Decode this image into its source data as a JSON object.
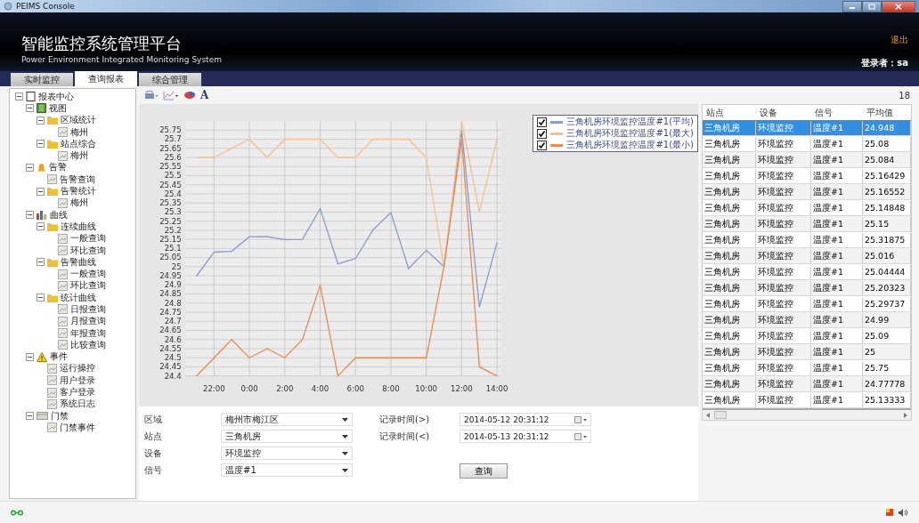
{
  "window": {
    "title": "PEIMS Console"
  },
  "header": {
    "title": "智能监控系统管理平台",
    "subtitle": "Power Environment Integrated Monitoring System",
    "logout": "退出",
    "user": "登录者：sa"
  },
  "tabs": [
    {
      "label": "实时监控",
      "selected": false
    },
    {
      "label": "查询报表",
      "selected": true
    },
    {
      "label": "综合管理",
      "selected": false
    }
  ],
  "tree": [
    {
      "label": "报表中心",
      "kind": "root",
      "expanded": true,
      "children": [
        {
          "label": "视图",
          "kind": "view",
          "expanded": true,
          "children": [
            {
              "label": "区域统计",
              "kind": "folder",
              "expanded": true,
              "children": [
                {
                  "label": "梅州",
                  "kind": "leaf"
                }
              ]
            },
            {
              "label": "站点综合",
              "kind": "folder",
              "expanded": true,
              "children": [
                {
                  "label": "梅州",
                  "kind": "leaf"
                }
              ]
            }
          ]
        },
        {
          "label": "告警",
          "kind": "alarm",
          "expanded": true,
          "children": [
            {
              "label": "告警查询",
              "kind": "leaf"
            },
            {
              "label": "告警统计",
              "kind": "folder",
              "expanded": true,
              "children": [
                {
                  "label": "梅州",
                  "kind": "leaf"
                }
              ]
            }
          ]
        },
        {
          "label": "曲线",
          "kind": "curve",
          "expanded": true,
          "children": [
            {
              "label": "连续曲线",
              "kind": "folder",
              "expanded": true,
              "children": [
                {
                  "label": "一般查询",
                  "kind": "leaf"
                },
                {
                  "label": "环比查询",
                  "kind": "leaf"
                }
              ]
            },
            {
              "label": "告警曲线",
              "kind": "folder",
              "expanded": true,
              "children": [
                {
                  "label": "一般查询",
                  "kind": "leaf"
                },
                {
                  "label": "环比查询",
                  "kind": "leaf"
                }
              ]
            },
            {
              "label": "统计曲线",
              "kind": "folder",
              "expanded": true,
              "children": [
                {
                  "label": "日报查询",
                  "kind": "leaf"
                },
                {
                  "label": "月报查询",
                  "kind": "leaf"
                },
                {
                  "label": "年报查询",
                  "kind": "leaf"
                },
                {
                  "label": "比较查询",
                  "kind": "leaf"
                }
              ]
            }
          ]
        },
        {
          "label": "事件",
          "kind": "event",
          "expanded": true,
          "children": [
            {
              "label": "运行操控",
              "kind": "leaf"
            },
            {
              "label": "用户登录",
              "kind": "leaf"
            },
            {
              "label": "客户登录",
              "kind": "leaf"
            },
            {
              "label": "系统日志",
              "kind": "leaf"
            }
          ]
        },
        {
          "label": "门禁",
          "kind": "door",
          "expanded": true,
          "children": [
            {
              "label": "门禁事件",
              "kind": "leaf"
            }
          ]
        }
      ]
    }
  ],
  "toolbar": {
    "font_label": "A"
  },
  "chart": {
    "chart_data": {
      "type": "line",
      "grid": true,
      "x": [
        "2014-05-12T21:00",
        "2014-05-12T22:00",
        "2014-05-12T23:00",
        "2014-05-13T00:00",
        "2014-05-13T01:00",
        "2014-05-13T02:00",
        "2014-05-13T03:00",
        "2014-05-13T04:00",
        "2014-05-13T05:00",
        "2014-05-13T06:00",
        "2014-05-13T07:00",
        "2014-05-13T08:00",
        "2014-05-13T09:00",
        "2014-05-13T10:00",
        "2014-05-13T11:00",
        "2014-05-13T12:00",
        "2014-05-13T13:00",
        "2014-05-13T14:00"
      ],
      "xlim": [
        "2014-05-12T20:24",
        "2014-05-13T14:12"
      ],
      "ylim": [
        24.4,
        25.8
      ],
      "xticks": [
        {
          "value": "2014-05-12T22:00",
          "label": "22:00"
        },
        {
          "value": "2014-05-13T00:00",
          "label": "0:00"
        },
        {
          "value": "2014-05-13T02:00",
          "label": "2:00"
        },
        {
          "value": "2014-05-13T04:00",
          "label": "4:00"
        },
        {
          "value": "2014-05-13T06:00",
          "label": "6:00"
        },
        {
          "value": "2014-05-13T08:00",
          "label": "8:00"
        },
        {
          "value": "2014-05-13T10:00",
          "label": "10:00"
        },
        {
          "value": "2014-05-13T12:00",
          "label": "12:00"
        },
        {
          "value": "2014-05-13T14:00",
          "label": "14:00"
        }
      ],
      "yticks": [
        24.4,
        24.45,
        24.5,
        24.55,
        24.6,
        24.65,
        24.7,
        24.75,
        24.8,
        24.85,
        24.9,
        24.95,
        25,
        25.05,
        25.1,
        25.15,
        25.2,
        25.25,
        25.3,
        25.35,
        25.4,
        25.45,
        25.5,
        25.55,
        25.6,
        25.65,
        25.7,
        25.75
      ],
      "series": [
        {
          "name": "三角机房环境监控温度#1(平均)",
          "color": "#8c9ccc",
          "values": [
            24.948,
            25.08,
            25.084,
            25.16429,
            25.16552,
            25.14848,
            25.15,
            25.31875,
            25.016,
            25.04444,
            25.20323,
            25.29737,
            24.99,
            25.09,
            25,
            25.75,
            24.77778,
            25.13333
          ]
        },
        {
          "name": "三角机房环境监控温度#1(最大)",
          "color": "#f5c08c",
          "values": [
            25.6,
            25.6,
            25.65,
            25.7,
            25.6,
            25.7,
            25.7,
            25.7,
            25.6,
            25.6,
            25.7,
            25.7,
            25.7,
            25.6,
            25,
            25.8,
            25.3,
            25.7
          ]
        },
        {
          "name": "三角机房环境监控温度#1(最小)",
          "color": "#ee8a55",
          "values": [
            24.4,
            24.5,
            24.6,
            24.5,
            24.55,
            24.5,
            24.6,
            24.9,
            24.4,
            24.5,
            24.5,
            24.5,
            24.5,
            24.5,
            25,
            25.7,
            24.45,
            24.4
          ]
        }
      ]
    },
    "legend": [
      {
        "checked": true
      },
      {
        "checked": true
      },
      {
        "checked": true
      }
    ]
  },
  "form": {
    "fields": [
      {
        "label": "区域",
        "value": "梅州市梅江区"
      },
      {
        "label": "站点",
        "value": "三角机房"
      },
      {
        "label": "设备",
        "value": "环境监控"
      },
      {
        "label": "信号",
        "value": "温度#1"
      }
    ],
    "times": [
      {
        "label": "记录时间(>)",
        "value": "2014-05-12 20:31:12"
      },
      {
        "label": "记录时间(<)",
        "value": "2014-05-13 20:31:12"
      }
    ],
    "button": "查询"
  },
  "table": {
    "count": "18",
    "columns": [
      "站点",
      "设备",
      "信号",
      "平均值"
    ],
    "rows": [
      {
        "cells": [
          "三角机房",
          "环境监控",
          "温度#1",
          "24.948"
        ],
        "selected": true
      },
      {
        "cells": [
          "三角机房",
          "环境监控",
          "温度#1",
          "25.08"
        ],
        "selected": false
      },
      {
        "cells": [
          "三角机房",
          "环境监控",
          "温度#1",
          "25.084"
        ],
        "selected": false
      },
      {
        "cells": [
          "三角机房",
          "环境监控",
          "温度#1",
          "25.16429"
        ],
        "selected": false
      },
      {
        "cells": [
          "三角机房",
          "环境监控",
          "温度#1",
          "25.16552"
        ],
        "selected": false
      },
      {
        "cells": [
          "三角机房",
          "环境监控",
          "温度#1",
          "25.14848"
        ],
        "selected": false
      },
      {
        "cells": [
          "三角机房",
          "环境监控",
          "温度#1",
          "25.15"
        ],
        "selected": false
      },
      {
        "cells": [
          "三角机房",
          "环境监控",
          "温度#1",
          "25.31875"
        ],
        "selected": false
      },
      {
        "cells": [
          "三角机房",
          "环境监控",
          "温度#1",
          "25.016"
        ],
        "selected": false
      },
      {
        "cells": [
          "三角机房",
          "环境监控",
          "温度#1",
          "25.04444"
        ],
        "selected": false
      },
      {
        "cells": [
          "三角机房",
          "环境监控",
          "温度#1",
          "25.20323"
        ],
        "selected": false
      },
      {
        "cells": [
          "三角机房",
          "环境监控",
          "温度#1",
          "25.29737"
        ],
        "selected": false
      },
      {
        "cells": [
          "三角机房",
          "环境监控",
          "温度#1",
          "24.99"
        ],
        "selected": false
      },
      {
        "cells": [
          "三角机房",
          "环境监控",
          "温度#1",
          "25.09"
        ],
        "selected": false
      },
      {
        "cells": [
          "三角机房",
          "环境监控",
          "温度#1",
          "25"
        ],
        "selected": false
      },
      {
        "cells": [
          "三角机房",
          "环境监控",
          "温度#1",
          "25.75"
        ],
        "selected": false
      },
      {
        "cells": [
          "三角机房",
          "环境监控",
          "温度#1",
          "24.77778"
        ],
        "selected": false
      },
      {
        "cells": [
          "三角机房",
          "环境监控",
          "温度#1",
          "25.13333"
        ],
        "selected": false
      }
    ]
  }
}
